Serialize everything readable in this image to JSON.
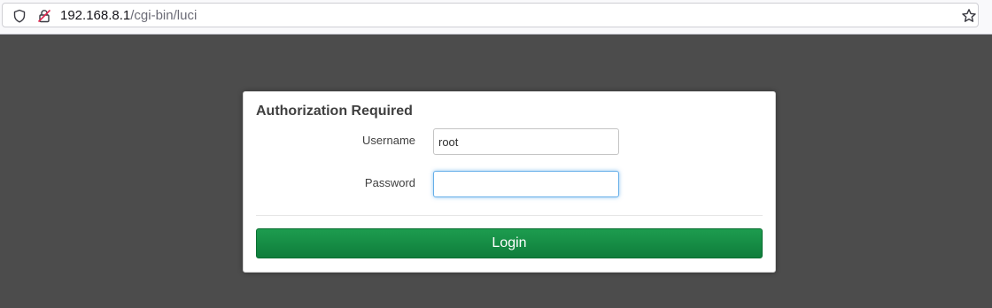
{
  "browser": {
    "url_host": "192.168.8.1",
    "url_path": "/cgi-bin/luci",
    "icons": {
      "left": [
        "shield-icon",
        "insecure-lock-icon"
      ],
      "right": [
        "bookmark-star-icon"
      ]
    }
  },
  "login": {
    "title": "Authorization Required",
    "username_label": "Username",
    "username_value": "root",
    "password_label": "Password",
    "password_value": "",
    "login_button": "Login"
  },
  "colors": {
    "page_background": "#4c4c4c",
    "button_green": "#148a44",
    "focus_blue": "#66afe9"
  }
}
